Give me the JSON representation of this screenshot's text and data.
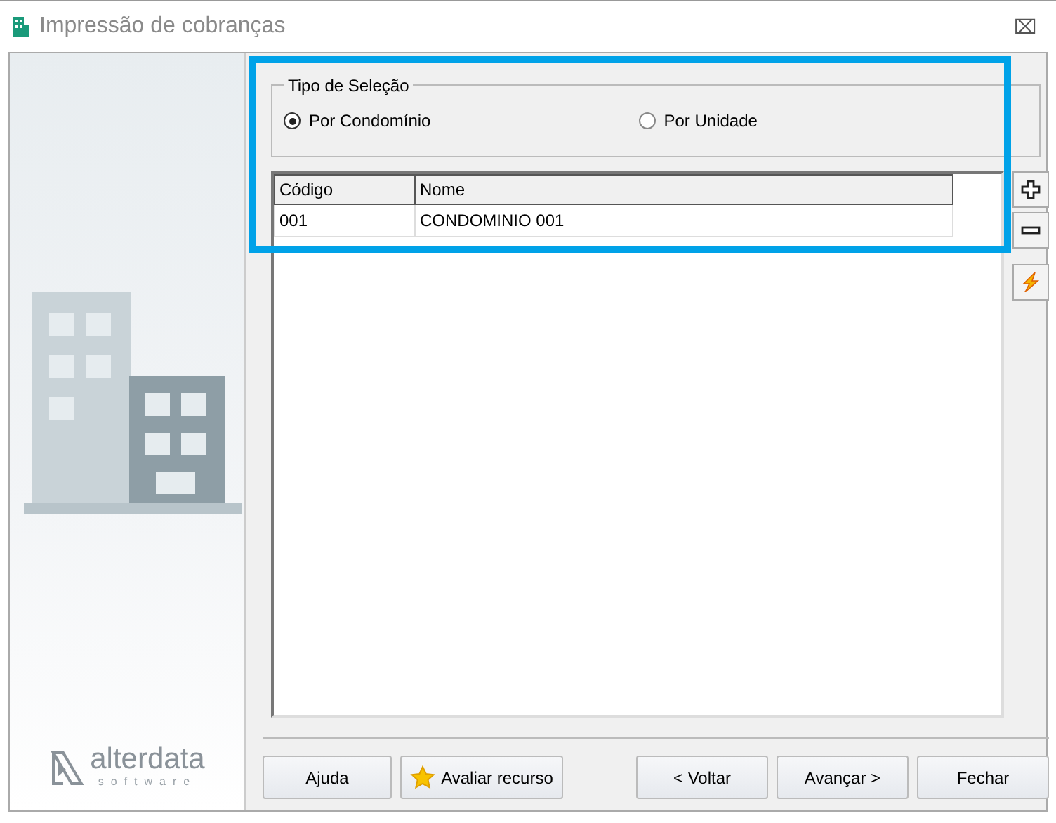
{
  "window": {
    "title": "Impressão de cobranças",
    "close": "⌧"
  },
  "sidebar": {
    "kind": "picture",
    "logo": {
      "name": "alterdata",
      "tagline": "software"
    }
  },
  "selection_type": {
    "title": "Tipo de Seleção",
    "options": [
      {
        "label": "Por Condomínio",
        "selected": true
      },
      {
        "label": "Por Unidade",
        "selected": false
      }
    ]
  },
  "table": {
    "columns": [
      "Código",
      "Nome"
    ],
    "rows": [
      {
        "cells": [
          "001",
          "CONDOMINIO 001"
        ],
        "selected": false
      }
    ]
  },
  "side_buttons": [
    {
      "kind": "add"
    },
    {
      "kind": "remove"
    },
    {
      "kind": "lightning"
    }
  ],
  "highlight": {
    "color": "#00a2e8"
  },
  "buttons": [
    {
      "label": "Ajuda",
      "kind": "help"
    },
    {
      "label": "Avaliar recurso",
      "kind": "rate"
    },
    {
      "label": "< Voltar",
      "kind": "back"
    },
    {
      "label": "Avançar >",
      "kind": "next"
    },
    {
      "label": "Fechar",
      "kind": "close"
    }
  ]
}
